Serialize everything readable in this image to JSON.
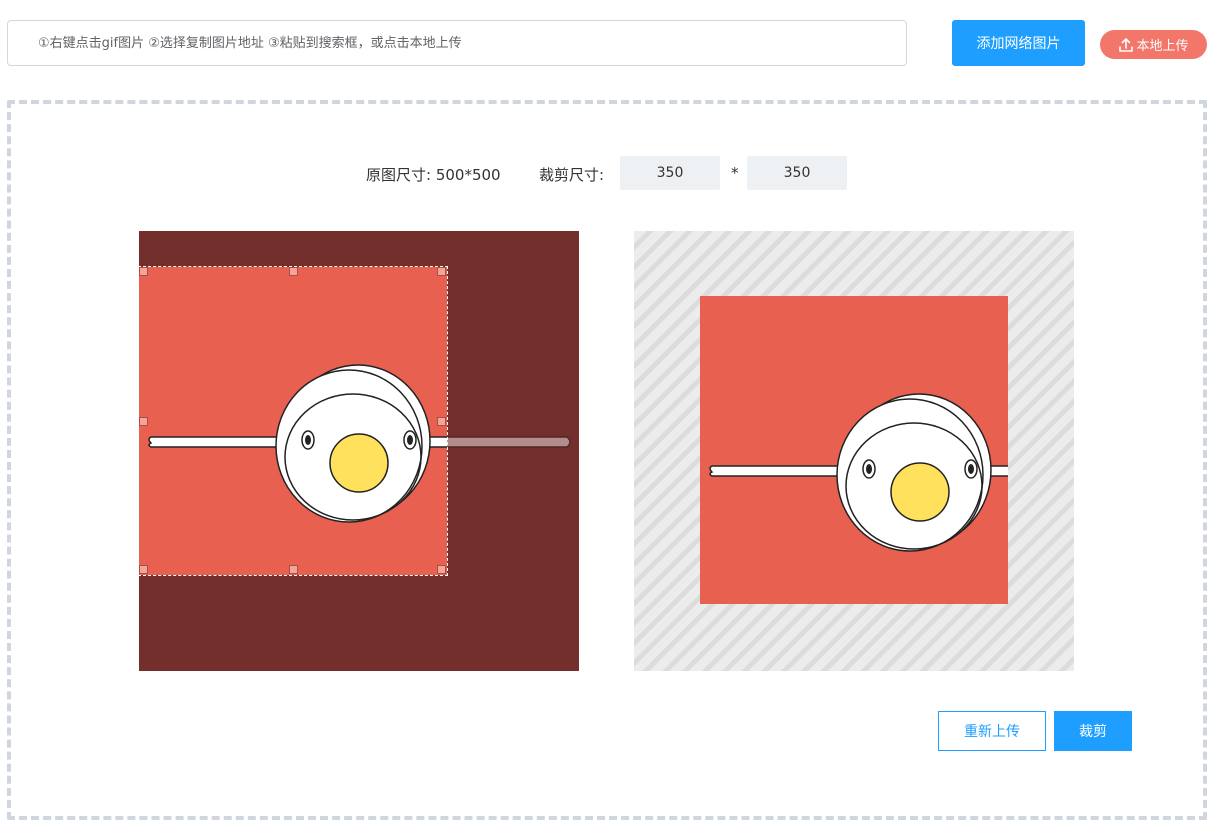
{
  "toolbar": {
    "url_placeholder": "①右键点击gif图片 ②选择复制图片地址 ③粘贴到搜索框，或点击本地上传",
    "url_value": "",
    "add_network_image_label": "添加网络图片",
    "local_upload_label": "本地上传",
    "local_upload_icon": "upload-icon"
  },
  "size": {
    "original_label": "原图尺寸:",
    "original_value": "500*500",
    "crop_label": "裁剪尺寸:",
    "crop_width": "350",
    "separator": "*",
    "crop_height": "350"
  },
  "actions": {
    "reupload_label": "重新上传",
    "crop_label": "裁剪"
  },
  "colors": {
    "primary": "#1e9fff",
    "upload_button": "#f2766a",
    "image_background": "#e8604f",
    "image_dim_background": "#722f2c",
    "yolk": "#ffe15e"
  }
}
